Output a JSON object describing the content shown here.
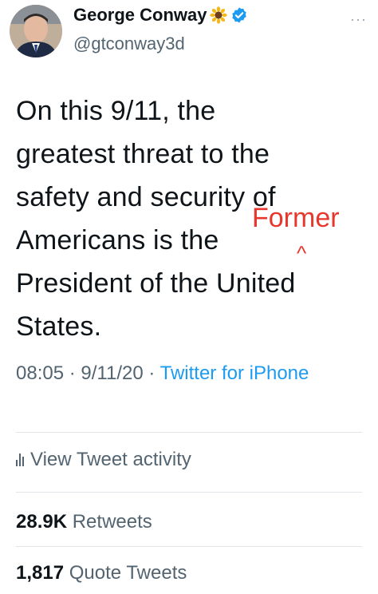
{
  "header": {
    "display_name": "George Conway",
    "handle": "@gtconway3d",
    "more_label": "···"
  },
  "tweet": {
    "lines": [
      "On this 9/11, the",
      "greatest threat to the",
      "safety and security of",
      "Americans is the",
      "President of the United",
      "States."
    ],
    "annotation": {
      "inserted_word": "Former",
      "caret": "^",
      "color": "#e8362d"
    }
  },
  "meta": {
    "time": "08:05",
    "separator": "·",
    "date": "9/11/20",
    "source": "Twitter for iPhone"
  },
  "activity": {
    "label": "View Tweet activity"
  },
  "stats": {
    "retweets_count": "28.9K",
    "retweets_label": "Retweets",
    "quotes_count": "1,817",
    "quotes_label": "Quote Tweets"
  },
  "colors": {
    "link": "#1d9bf0",
    "secondary_text": "#536471",
    "verified": "#1d9bf0"
  }
}
